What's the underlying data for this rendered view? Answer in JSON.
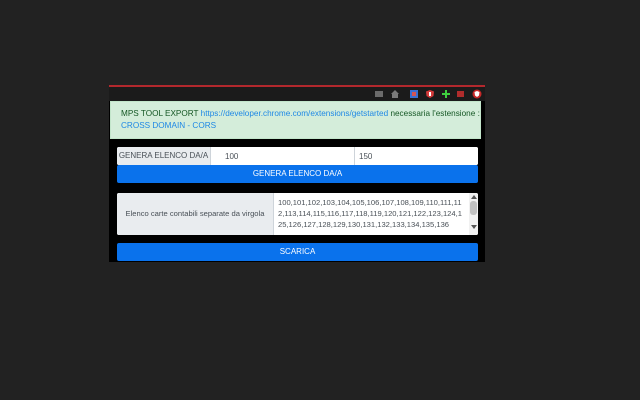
{
  "notice": {
    "prefix": "MPS TOOL EXPORT",
    "link": "https://developer.chrome.com/extensions/getstarted",
    "suffix": "necessaria l'estensione :",
    "line2": "CROSS DOMAIN - CORS"
  },
  "range": {
    "label": "GENERA ELENCO DA/A",
    "from_value": "100",
    "to_value": "150"
  },
  "buttons": {
    "genera_label": "GENERA ELENCO DA/A",
    "scarica_label": "SCARICA"
  },
  "list": {
    "label": "Elenco carte contabili separate da virgola",
    "value": "100,101,102,103,104,105,106,107,108,109,110,111,112,113,114,115,116,117,118,119,120,121,122,123,124,125,126,127,128,129,130,131,132,133,134,135,136"
  },
  "icons": {
    "colors": {
      "accent_red": "#b3282d",
      "button_blue": "#0a72ec",
      "notice_bg": "#d4edda",
      "link_blue": "#1e88e5"
    }
  }
}
